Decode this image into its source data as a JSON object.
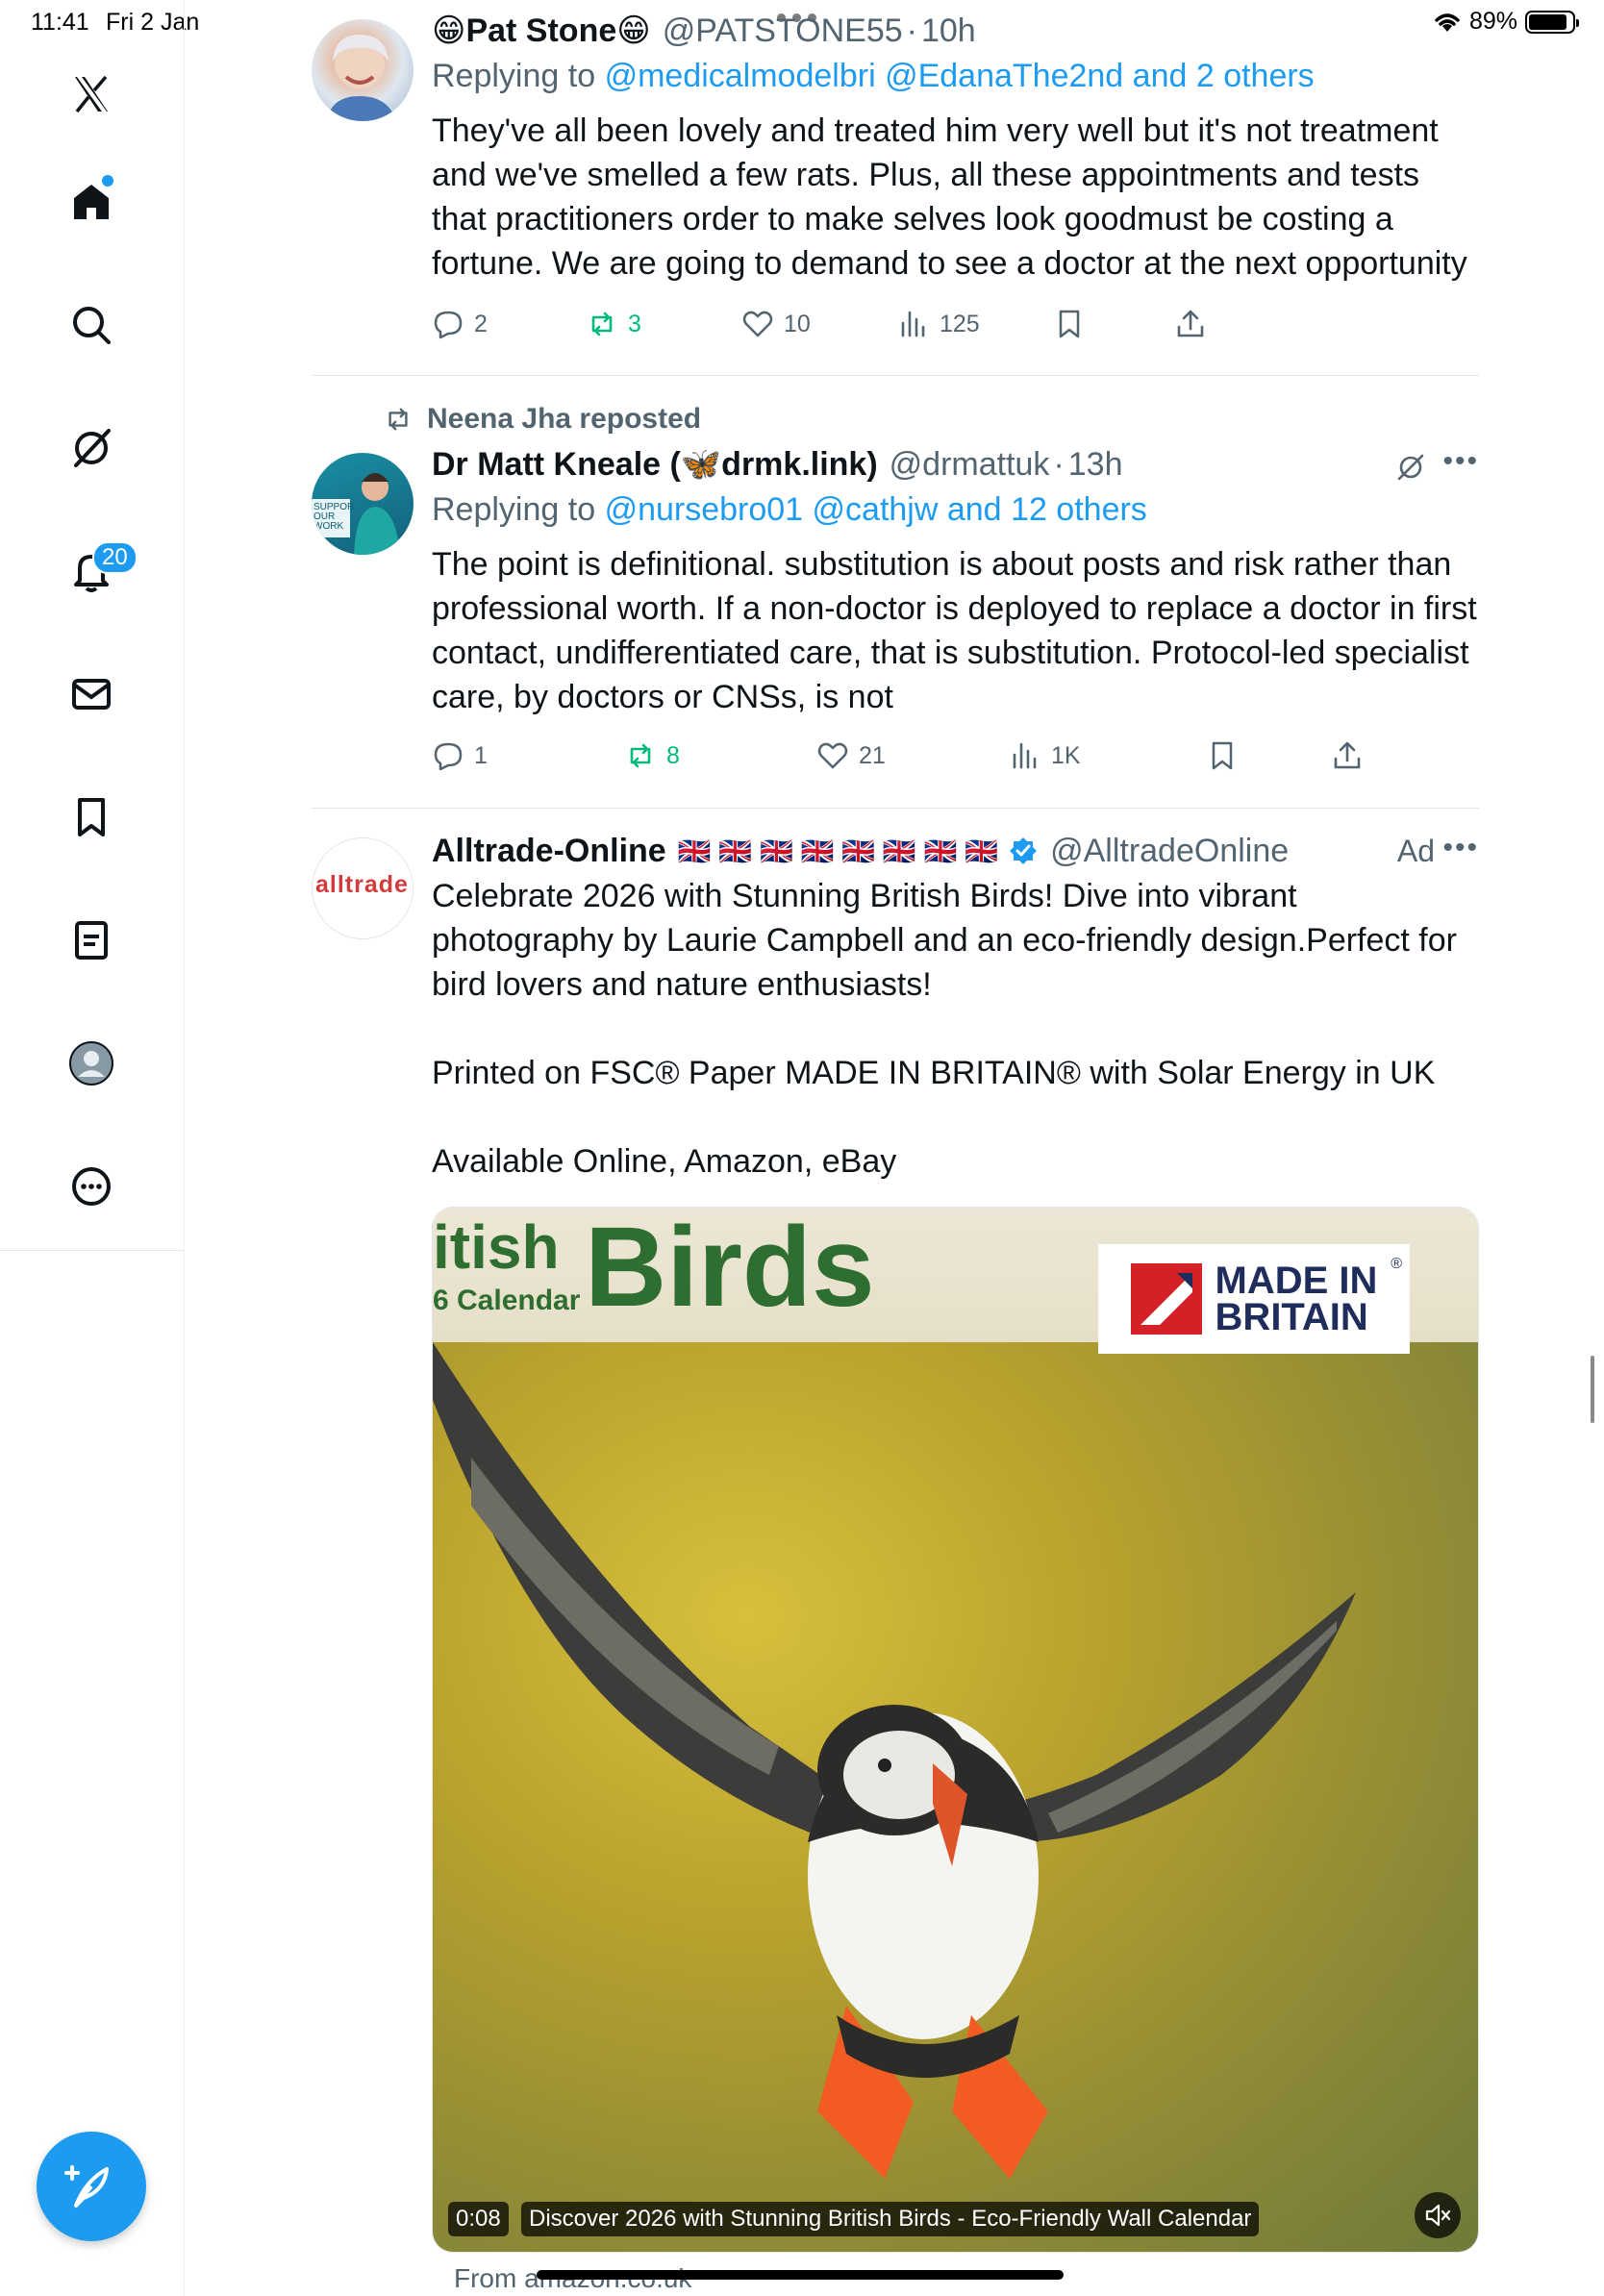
{
  "status_bar": {
    "time": "11:41",
    "date": "Fri 2 Jan",
    "battery": "89%",
    "battery_level": 0.89
  },
  "sidebar": {
    "items": [
      {
        "name": "x-logo-icon"
      },
      {
        "name": "home-icon"
      },
      {
        "name": "search-icon"
      },
      {
        "name": "grok-icon"
      },
      {
        "name": "notifications-icon",
        "badge": "20"
      },
      {
        "name": "messages-icon"
      },
      {
        "name": "bookmarks-icon"
      },
      {
        "name": "lists-icon"
      },
      {
        "name": "profile-icon"
      },
      {
        "name": "more-icon"
      }
    ],
    "compose": "compose-icon"
  },
  "tweets": [
    {
      "name_prefix": "😁",
      "name": "Pat Stone",
      "name_suffix": "😁",
      "handle": "@PATSTONE55",
      "time": "10h",
      "reply_label": "Replying to",
      "reply_to": "@medicalmodelbri @EdanaThe2nd and 2 others",
      "text": "They've all been lovely and treated him very well but it's not treatment and we've smelled a few rats. Plus, all these appointments and tests that practitioners order to make selves look goodmust be costing a fortune. We are going to demand to see a doctor at the next opportunity",
      "replies": "2",
      "reposts": "3",
      "likes": "10",
      "views": "125"
    },
    {
      "repost_label": "Neena Jha reposted",
      "name_part1": "Dr Matt Kneale (",
      "name_emoji": "🦋",
      "name_part2": "drmk.link)",
      "handle": "@drmattuk",
      "time": "13h",
      "reply_label": "Replying to",
      "reply_to": "@nursebro01 @cathjw and 12 others",
      "text": "The point is definitional. substitution is about posts and risk rather than professional worth. If a non-doctor is deployed to replace a doctor in first contact, undifferentiated care, that is substitution. Protocol-led specialist care, by doctors or CNSs, is not",
      "replies": "1",
      "reposts": "8",
      "likes": "21",
      "views": "1K",
      "avatar_text": "SUPPOR OUR WORK"
    },
    {
      "name": "Alltrade-Online",
      "flags": "🇬🇧 🇬🇧 🇬🇧 🇬🇧 🇬🇧 🇬🇧 🇬🇧 🇬🇧",
      "handle": "@AlltradeOnline",
      "ad_label": "Ad",
      "avatar_text": "alltrade",
      "text": "Celebrate 2026 with Stunning British Birds! Dive into vibrant photography by Laurie Campbell and an eco-friendly design.Perfect for bird lovers and nature enthusiasts!\n\nPrinted on FSC® Paper MADE IN BRITAIN® with Solar Energy in UK\n\nAvailable Online, Amazon, eBay",
      "media": {
        "cover_title_left": "itish",
        "cover_subtitle_left": "6 Calendar",
        "cover_title_big": "Birds",
        "badge_line1": "MADE IN",
        "badge_line2": "BRITAIN",
        "badge_reg": "®",
        "video_time": "0:08",
        "video_title": "Discover 2026 with Stunning British Birds - Eco-Friendly Wall Calendar"
      },
      "from": "From amazon.co.uk"
    }
  ],
  "colors": {
    "accent": "#1d9bf0",
    "repost_green": "#00ba7c",
    "muted": "#536471"
  }
}
